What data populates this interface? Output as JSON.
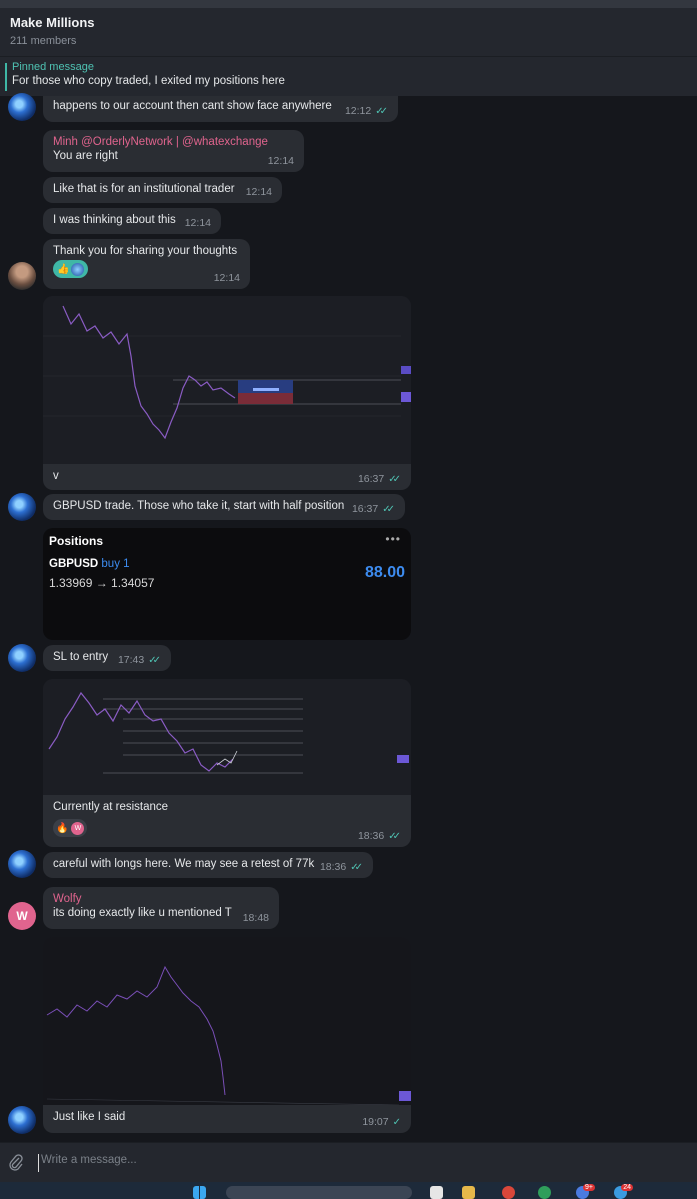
{
  "header": {
    "title": "Make Millions",
    "members": "211 members"
  },
  "pinned": {
    "label": "Pinned message",
    "text": "For those who copy traded, I exited my positions here"
  },
  "messages": {
    "m0": {
      "text": "happens to our account then cant show face anywhere",
      "time": "12:12"
    },
    "m1": {
      "sender": "Minh @OrderlyNetwork | @whatexchange",
      "text": "You are right",
      "time": "12:14"
    },
    "m2": {
      "text": "Like that is for an institutional trader",
      "time": "12:14"
    },
    "m3": {
      "text": "I was thinking about this",
      "time": "12:14"
    },
    "m4": {
      "text": "Thank you for sharing your thoughts",
      "time": "12:14"
    },
    "m5": {
      "caption": "v",
      "time": "16:37"
    },
    "m6": {
      "text": "GBPUSD trade. Those who take it, start with half position",
      "time": "16:37"
    },
    "m8": {
      "text": "SL to entry",
      "time": "17:43"
    },
    "m9": {
      "caption": "Currently at resistance",
      "time": "18:36"
    },
    "m10": {
      "text": "careful with longs here. We may see a retest of 77k",
      "time": "18:36"
    },
    "m11": {
      "sender": "Wolfy",
      "text": "its doing exactly like u mentioned T",
      "time": "18:48"
    },
    "m12": {
      "caption": "Just like I said",
      "time": "19:07"
    }
  },
  "positions": {
    "title": "Positions",
    "more": "•••",
    "pair": "GBPUSD",
    "side": "buy 1",
    "prices": "1.33969 → 1.34057",
    "pnl": "88.00"
  },
  "avatar_letter": "W",
  "reaction_letter": "W",
  "composer": {
    "placeholder": "Write a message..."
  },
  "icons": {
    "check": "double-check-icon",
    "attach": "paperclip-icon",
    "reactions": [
      "thumbs-up-icon",
      "fire-icon"
    ]
  },
  "colors": {
    "accent": "#4fc3b3",
    "sender": "#e0648e",
    "pnl": "#3d8cf0",
    "bubble": "#2a2d33",
    "background": "#15171c"
  }
}
